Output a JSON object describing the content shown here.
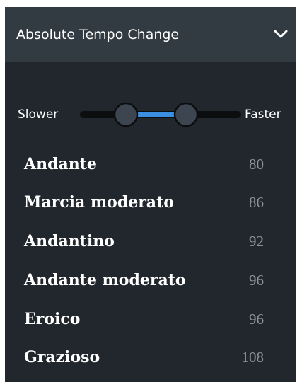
{
  "header": {
    "title": "Absolute Tempo Change",
    "icon": "chevron-down-icon"
  },
  "slider": {
    "left_label": "Slower",
    "right_label": "Faster",
    "accent": "#3a8fe0"
  },
  "tempos": [
    {
      "name": "Andante",
      "bpm": "80"
    },
    {
      "name": "Marcia moderato",
      "bpm": "86"
    },
    {
      "name": "Andantino",
      "bpm": "92"
    },
    {
      "name": "Andante moderato",
      "bpm": "96"
    },
    {
      "name": "Eroico",
      "bpm": "96"
    },
    {
      "name": "Grazioso",
      "bpm": "108"
    }
  ]
}
